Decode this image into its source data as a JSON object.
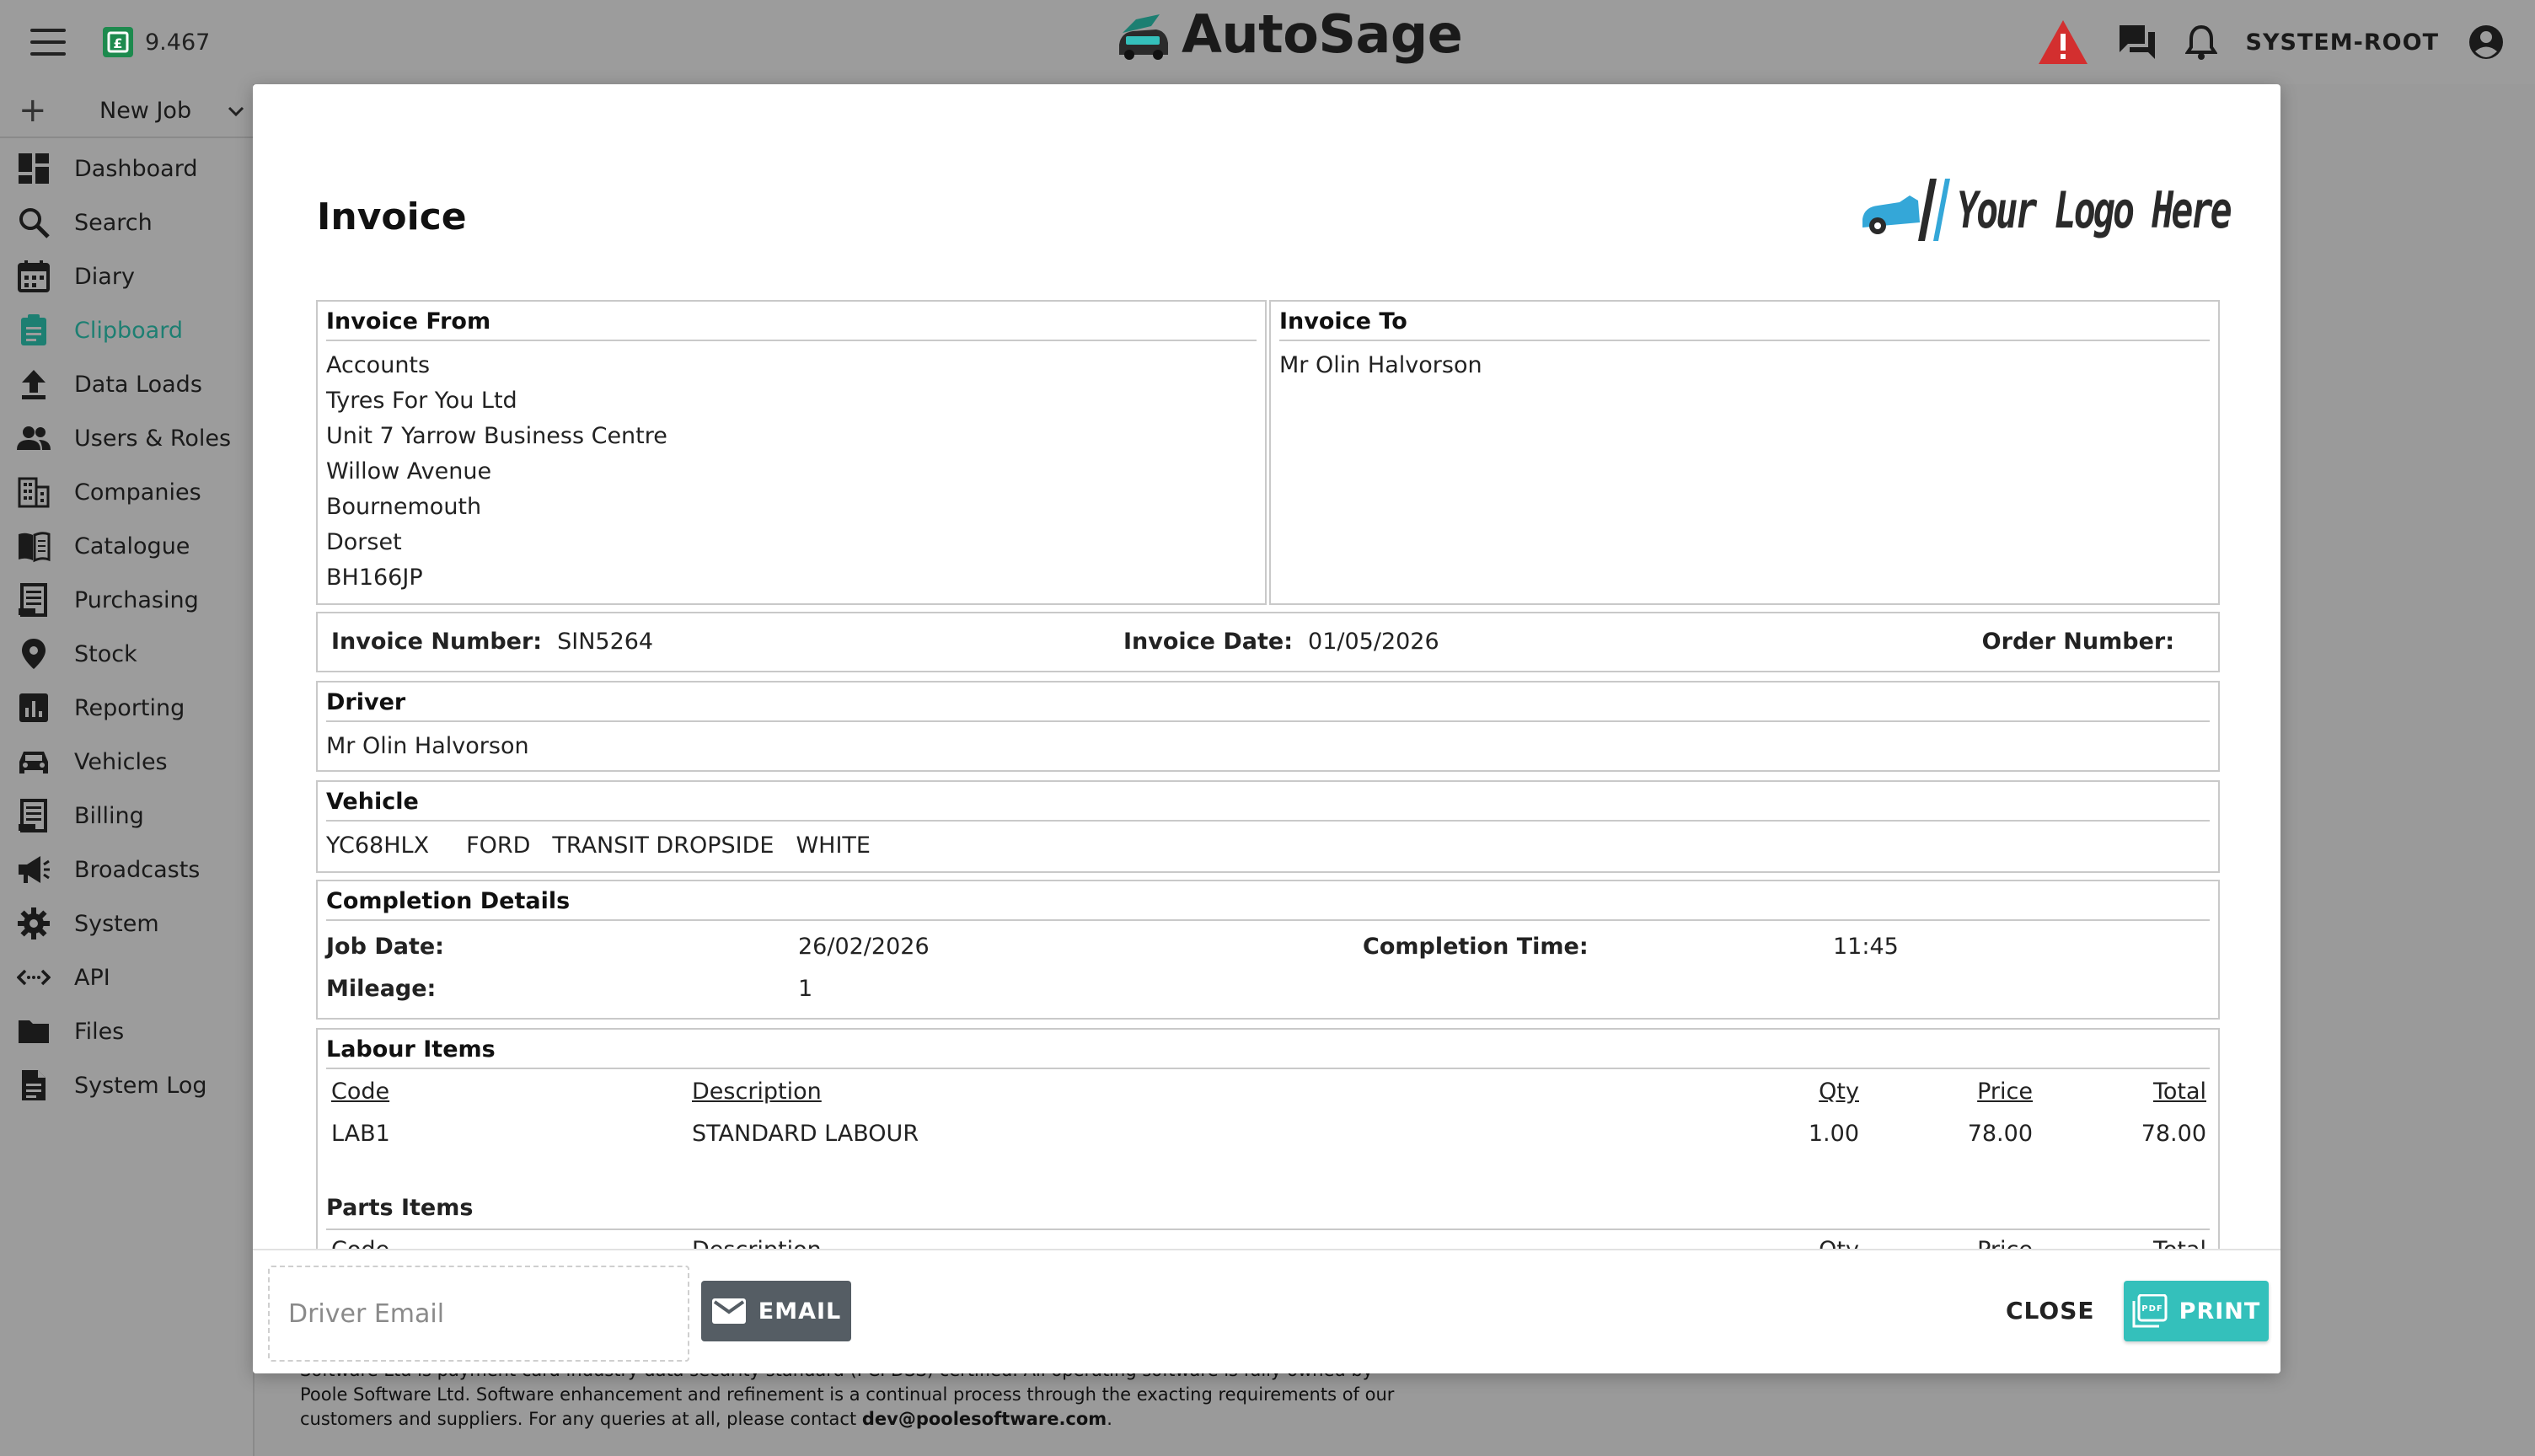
{
  "app": {
    "brand": "AutoSage",
    "credit_balance": "9.467",
    "username": "SYSTEM-ROOT",
    "colors": {
      "accent": "#34c0bb",
      "active_nav": "#1d7f72",
      "warning": "#d32f2f"
    }
  },
  "sidebar": {
    "new_job_label": "New Job",
    "items": [
      {
        "label": "Dashboard",
        "icon": "dashboard-icon"
      },
      {
        "label": "Search",
        "icon": "search-icon"
      },
      {
        "label": "Diary",
        "icon": "calendar-icon"
      },
      {
        "label": "Clipboard",
        "icon": "clipboard-icon",
        "active": true
      },
      {
        "label": "Data Loads",
        "icon": "upload-icon"
      },
      {
        "label": "Users & Roles",
        "icon": "users-icon"
      },
      {
        "label": "Companies",
        "icon": "building-icon"
      },
      {
        "label": "Catalogue",
        "icon": "book-icon"
      },
      {
        "label": "Purchasing",
        "icon": "receipt-icon"
      },
      {
        "label": "Stock",
        "icon": "location-pin-icon"
      },
      {
        "label": "Reporting",
        "icon": "chart-icon"
      },
      {
        "label": "Vehicles",
        "icon": "car-icon"
      },
      {
        "label": "Billing",
        "icon": "billing-icon"
      },
      {
        "label": "Broadcasts",
        "icon": "megaphone-icon"
      },
      {
        "label": "System",
        "icon": "gear-icon"
      },
      {
        "label": "API",
        "icon": "code-icon"
      },
      {
        "label": "Files",
        "icon": "folder-icon"
      },
      {
        "label": "System Log",
        "icon": "document-icon"
      }
    ]
  },
  "background_footer": {
    "line1": "Software Ltd is payment card industry data security standard (PCI DSS) certified. All operating software is fully owned by",
    "line2": "Poole Software Ltd. Software enhancement and refinement is a continual process through the exacting requirements of our",
    "line3_prefix": "customers and suppliers. For any queries at all, please contact ",
    "email": "dev@poolesoftware.com",
    "line3_suffix": "."
  },
  "invoice": {
    "title": "Invoice",
    "logo_text": "Your Logo Here",
    "from": {
      "heading": "Invoice From",
      "lines": [
        "Accounts",
        "Tyres For You Ltd",
        "Unit 7 Yarrow Business Centre",
        "Willow Avenue",
        "Bournemouth",
        "Dorset",
        "BH166JP"
      ]
    },
    "to": {
      "heading": "Invoice To",
      "lines": [
        "Mr Olin Halvorson"
      ]
    },
    "meta": {
      "number_label": "Invoice Number:",
      "number": "SIN5264",
      "date_label": "Invoice Date:",
      "date": "01/05/2026",
      "order_label": "Order Number:",
      "order": ""
    },
    "driver": {
      "heading": "Driver",
      "name": "Mr Olin Halvorson"
    },
    "vehicle": {
      "heading": "Vehicle",
      "reg": "YC68HLX",
      "make": "FORD",
      "model": "TRANSIT DROPSIDE",
      "colour": "WHITE"
    },
    "completion": {
      "heading": "Completion Details",
      "job_date_label": "Job Date:",
      "job_date": "26/02/2026",
      "time_label": "Completion Time:",
      "time": "11:45",
      "mileage_label": "Mileage:",
      "mileage": "1"
    },
    "labour": {
      "heading": "Labour Items",
      "columns": [
        "Code",
        "Description",
        "Qty",
        "Price",
        "Total"
      ],
      "rows": [
        {
          "code": "LAB1",
          "description": "STANDARD LABOUR",
          "qty": "1.00",
          "price": "78.00",
          "total": "78.00"
        }
      ]
    },
    "parts": {
      "heading": "Parts Items",
      "columns": [
        "Code",
        "Description",
        "Qty",
        "Price",
        "Total"
      ]
    }
  },
  "footer": {
    "email_placeholder": "Driver Email",
    "email_label": "EMAIL",
    "close_label": "CLOSE",
    "print_label": "PRINT"
  }
}
